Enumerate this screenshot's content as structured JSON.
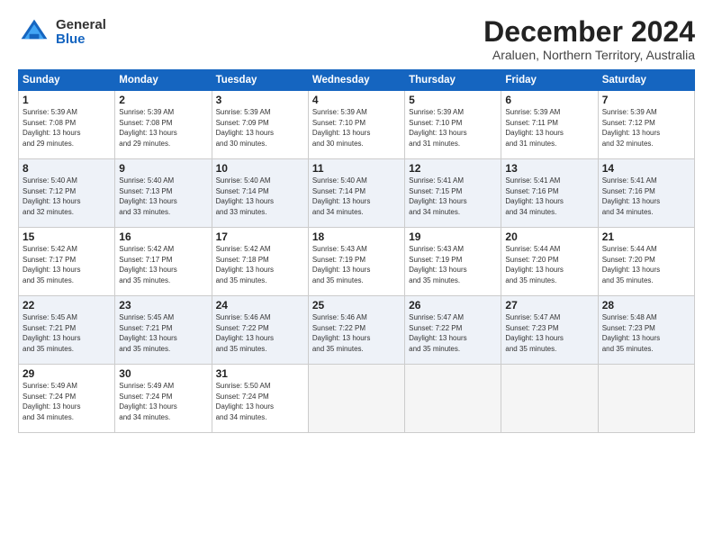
{
  "logo": {
    "general": "General",
    "blue": "Blue"
  },
  "title": "December 2024",
  "location": "Araluen, Northern Territory, Australia",
  "days_of_week": [
    "Sunday",
    "Monday",
    "Tuesday",
    "Wednesday",
    "Thursday",
    "Friday",
    "Saturday"
  ],
  "weeks": [
    [
      {
        "day": "1",
        "info": "Sunrise: 5:39 AM\nSunset: 7:08 PM\nDaylight: 13 hours\nand 29 minutes."
      },
      {
        "day": "2",
        "info": "Sunrise: 5:39 AM\nSunset: 7:08 PM\nDaylight: 13 hours\nand 29 minutes."
      },
      {
        "day": "3",
        "info": "Sunrise: 5:39 AM\nSunset: 7:09 PM\nDaylight: 13 hours\nand 30 minutes."
      },
      {
        "day": "4",
        "info": "Sunrise: 5:39 AM\nSunset: 7:10 PM\nDaylight: 13 hours\nand 30 minutes."
      },
      {
        "day": "5",
        "info": "Sunrise: 5:39 AM\nSunset: 7:10 PM\nDaylight: 13 hours\nand 31 minutes."
      },
      {
        "day": "6",
        "info": "Sunrise: 5:39 AM\nSunset: 7:11 PM\nDaylight: 13 hours\nand 31 minutes."
      },
      {
        "day": "7",
        "info": "Sunrise: 5:39 AM\nSunset: 7:12 PM\nDaylight: 13 hours\nand 32 minutes."
      }
    ],
    [
      {
        "day": "8",
        "info": "Sunrise: 5:40 AM\nSunset: 7:12 PM\nDaylight: 13 hours\nand 32 minutes."
      },
      {
        "day": "9",
        "info": "Sunrise: 5:40 AM\nSunset: 7:13 PM\nDaylight: 13 hours\nand 33 minutes."
      },
      {
        "day": "10",
        "info": "Sunrise: 5:40 AM\nSunset: 7:14 PM\nDaylight: 13 hours\nand 33 minutes."
      },
      {
        "day": "11",
        "info": "Sunrise: 5:40 AM\nSunset: 7:14 PM\nDaylight: 13 hours\nand 34 minutes."
      },
      {
        "day": "12",
        "info": "Sunrise: 5:41 AM\nSunset: 7:15 PM\nDaylight: 13 hours\nand 34 minutes."
      },
      {
        "day": "13",
        "info": "Sunrise: 5:41 AM\nSunset: 7:16 PM\nDaylight: 13 hours\nand 34 minutes."
      },
      {
        "day": "14",
        "info": "Sunrise: 5:41 AM\nSunset: 7:16 PM\nDaylight: 13 hours\nand 34 minutes."
      }
    ],
    [
      {
        "day": "15",
        "info": "Sunrise: 5:42 AM\nSunset: 7:17 PM\nDaylight: 13 hours\nand 35 minutes."
      },
      {
        "day": "16",
        "info": "Sunrise: 5:42 AM\nSunset: 7:17 PM\nDaylight: 13 hours\nand 35 minutes."
      },
      {
        "day": "17",
        "info": "Sunrise: 5:42 AM\nSunset: 7:18 PM\nDaylight: 13 hours\nand 35 minutes."
      },
      {
        "day": "18",
        "info": "Sunrise: 5:43 AM\nSunset: 7:19 PM\nDaylight: 13 hours\nand 35 minutes."
      },
      {
        "day": "19",
        "info": "Sunrise: 5:43 AM\nSunset: 7:19 PM\nDaylight: 13 hours\nand 35 minutes."
      },
      {
        "day": "20",
        "info": "Sunrise: 5:44 AM\nSunset: 7:20 PM\nDaylight: 13 hours\nand 35 minutes."
      },
      {
        "day": "21",
        "info": "Sunrise: 5:44 AM\nSunset: 7:20 PM\nDaylight: 13 hours\nand 35 minutes."
      }
    ],
    [
      {
        "day": "22",
        "info": "Sunrise: 5:45 AM\nSunset: 7:21 PM\nDaylight: 13 hours\nand 35 minutes."
      },
      {
        "day": "23",
        "info": "Sunrise: 5:45 AM\nSunset: 7:21 PM\nDaylight: 13 hours\nand 35 minutes."
      },
      {
        "day": "24",
        "info": "Sunrise: 5:46 AM\nSunset: 7:22 PM\nDaylight: 13 hours\nand 35 minutes."
      },
      {
        "day": "25",
        "info": "Sunrise: 5:46 AM\nSunset: 7:22 PM\nDaylight: 13 hours\nand 35 minutes."
      },
      {
        "day": "26",
        "info": "Sunrise: 5:47 AM\nSunset: 7:22 PM\nDaylight: 13 hours\nand 35 minutes."
      },
      {
        "day": "27",
        "info": "Sunrise: 5:47 AM\nSunset: 7:23 PM\nDaylight: 13 hours\nand 35 minutes."
      },
      {
        "day": "28",
        "info": "Sunrise: 5:48 AM\nSunset: 7:23 PM\nDaylight: 13 hours\nand 35 minutes."
      }
    ],
    [
      {
        "day": "29",
        "info": "Sunrise: 5:49 AM\nSunset: 7:24 PM\nDaylight: 13 hours\nand 34 minutes."
      },
      {
        "day": "30",
        "info": "Sunrise: 5:49 AM\nSunset: 7:24 PM\nDaylight: 13 hours\nand 34 minutes."
      },
      {
        "day": "31",
        "info": "Sunrise: 5:50 AM\nSunset: 7:24 PM\nDaylight: 13 hours\nand 34 minutes."
      },
      {
        "day": "",
        "info": ""
      },
      {
        "day": "",
        "info": ""
      },
      {
        "day": "",
        "info": ""
      },
      {
        "day": "",
        "info": ""
      }
    ]
  ]
}
